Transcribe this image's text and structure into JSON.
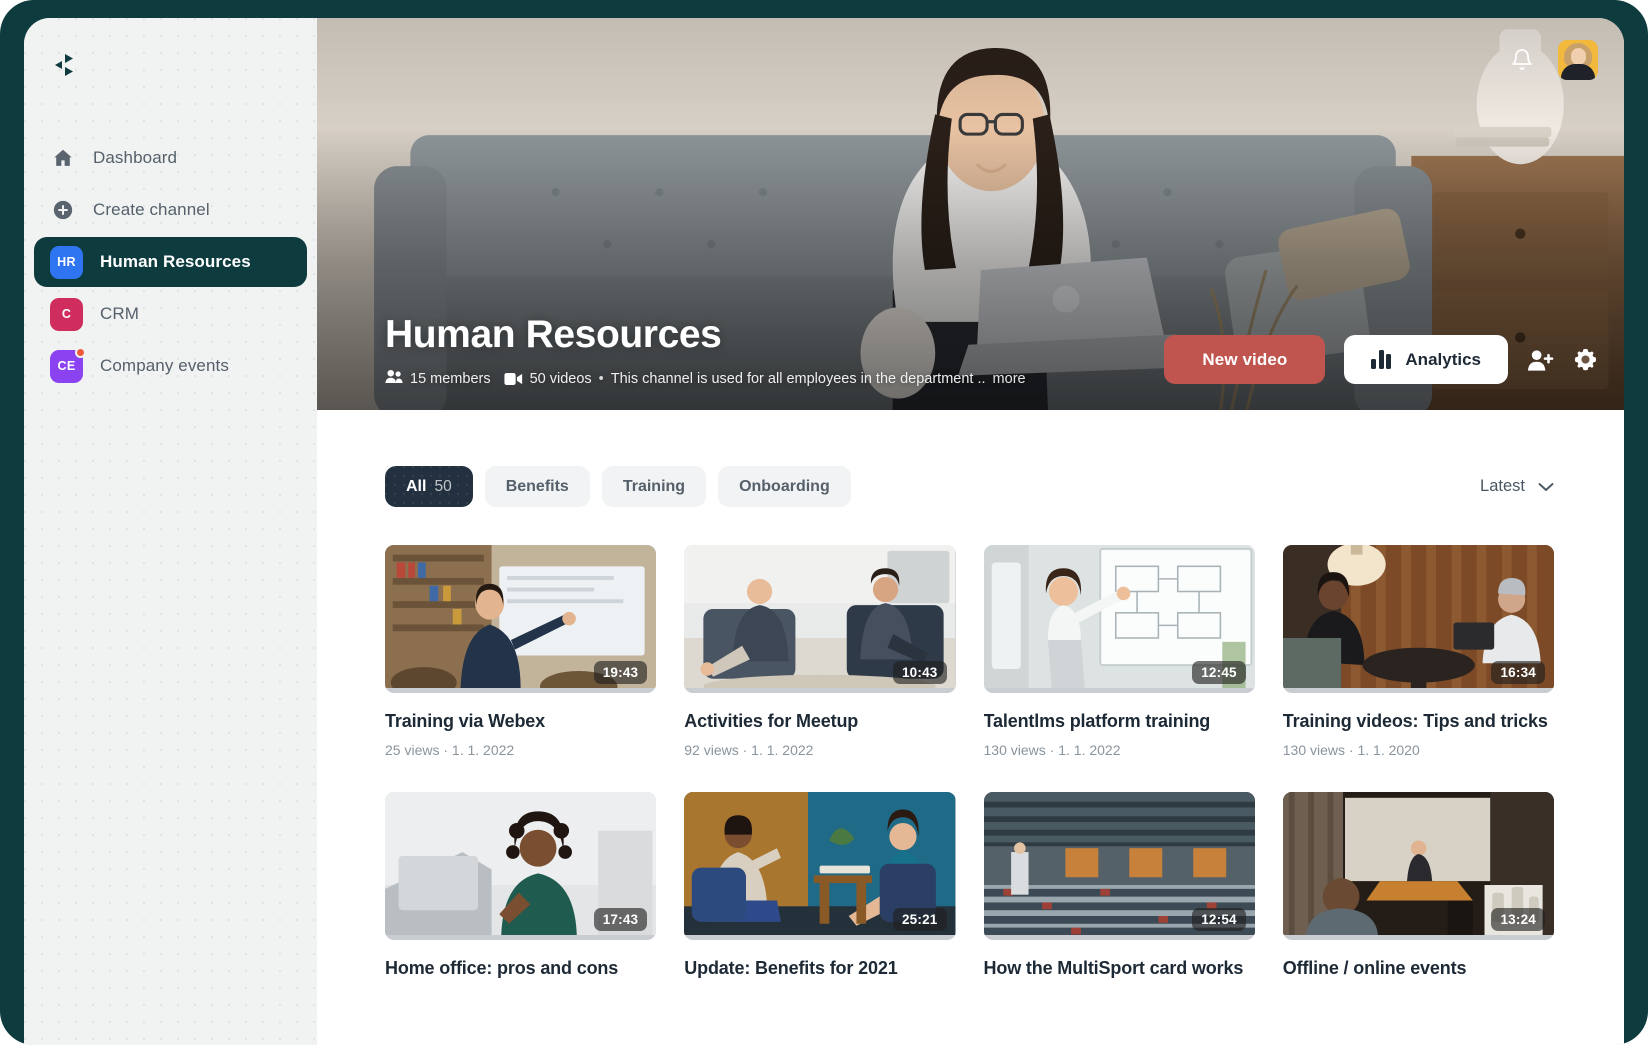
{
  "app": {
    "logo_icon": "chevron-play-logo-icon",
    "accent_primary": "#0e3b3e",
    "accent_button": "#c0544f",
    "chip_active_bg": "#22303f"
  },
  "sidebar": {
    "items": [
      {
        "label": "Dashboard",
        "icon": "home-icon",
        "type": "icon",
        "active": false
      },
      {
        "label": "Create channel",
        "icon": "plus-circle-icon",
        "type": "icon",
        "active": false
      },
      {
        "label": "Human Resources",
        "icon": "hr-badge",
        "type": "badge",
        "active": true,
        "initials": "HR",
        "color": "#2f74f0",
        "dot": false
      },
      {
        "label": "CRM",
        "icon": "crm-badge",
        "type": "badge",
        "active": false,
        "initials": "C",
        "color": "#cf2d5e",
        "dot": false
      },
      {
        "label": "Company events",
        "icon": "ce-badge",
        "type": "badge",
        "active": false,
        "initials": "CE",
        "color": "#8b42f0",
        "dot": true
      }
    ]
  },
  "hero": {
    "title": "Human Resources",
    "members": "15 members",
    "videos": "50 videos",
    "separator": "•",
    "description": "This channel is used for all employees in the department ..",
    "more_label": "more",
    "members_icon": "people-icon",
    "videos_icon": "video-camera-icon",
    "new_video_label": "New video",
    "analytics_label": "Analytics",
    "analytics_icon": "bar-chart-icon",
    "add_member_icon": "add-user-icon",
    "settings_icon": "gear-icon",
    "notifications_icon": "bell-icon",
    "avatar_icon": "user-avatar"
  },
  "filters": {
    "chips": [
      {
        "label": "All",
        "count": "50",
        "active": true
      },
      {
        "label": "Benefits",
        "count": "",
        "active": false
      },
      {
        "label": "Training",
        "count": "",
        "active": false
      },
      {
        "label": "Onboarding",
        "count": "",
        "active": false
      }
    ],
    "sort": {
      "label": "Latest",
      "icon": "chevron-down-icon"
    }
  },
  "videos": [
    {
      "title": "Training via Webex",
      "views": "25 views",
      "date": "1. 1. 2022",
      "duration": "19:43",
      "scene": "s1"
    },
    {
      "title": "Activities for Meetup",
      "views": "92 views",
      "date": "1. 1. 2022",
      "duration": "10:43",
      "scene": "s2"
    },
    {
      "title": "Talentlms platform training",
      "views": "130 views",
      "date": "1. 1. 2022",
      "duration": "12:45",
      "scene": "s3"
    },
    {
      "title": "Training videos: Tips and tricks",
      "views": "130 views",
      "date": "1. 1. 2020",
      "duration": "16:34",
      "scene": "s4"
    },
    {
      "title": "Home office: pros and cons",
      "views": "",
      "date": "",
      "duration": "17:43",
      "scene": "s5"
    },
    {
      "title": "Update: Benefits for 2021",
      "views": "",
      "date": "",
      "duration": "25:21",
      "scene": "s6"
    },
    {
      "title": "How the MultiSport card works",
      "views": "",
      "date": "",
      "duration": "12:54",
      "scene": "s7"
    },
    {
      "title": "Offline / online events",
      "views": "",
      "date": "",
      "duration": "13:24",
      "scene": "s8"
    }
  ],
  "meta": {
    "views_date_separator": "·"
  }
}
